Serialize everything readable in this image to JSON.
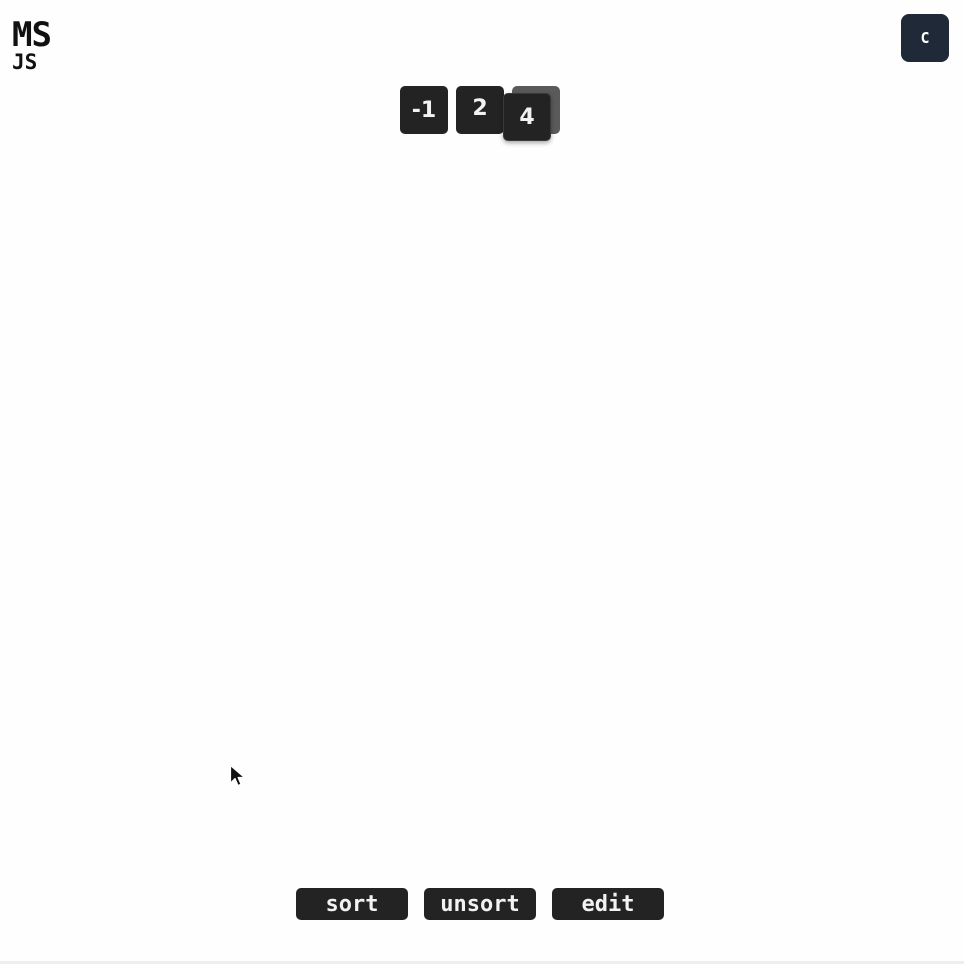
{
  "logo": {
    "line1": "MS",
    "line2": "JS"
  },
  "corner_button": {
    "label": "C"
  },
  "tiles": {
    "values": [
      "-1",
      "2",
      "4"
    ],
    "dragging_value": "4"
  },
  "actions": {
    "sort_label": "sort",
    "unsort_label": "unsort",
    "edit_label": "edit"
  },
  "colors": {
    "tile_background": "#232323",
    "tile_text": "#f2f2f2",
    "ghost_slot": "#5a5a5a",
    "corner_button": "#1f2937",
    "page_background": "#fefefe"
  },
  "icons": {
    "pointer": "mouse-pointer-icon"
  }
}
